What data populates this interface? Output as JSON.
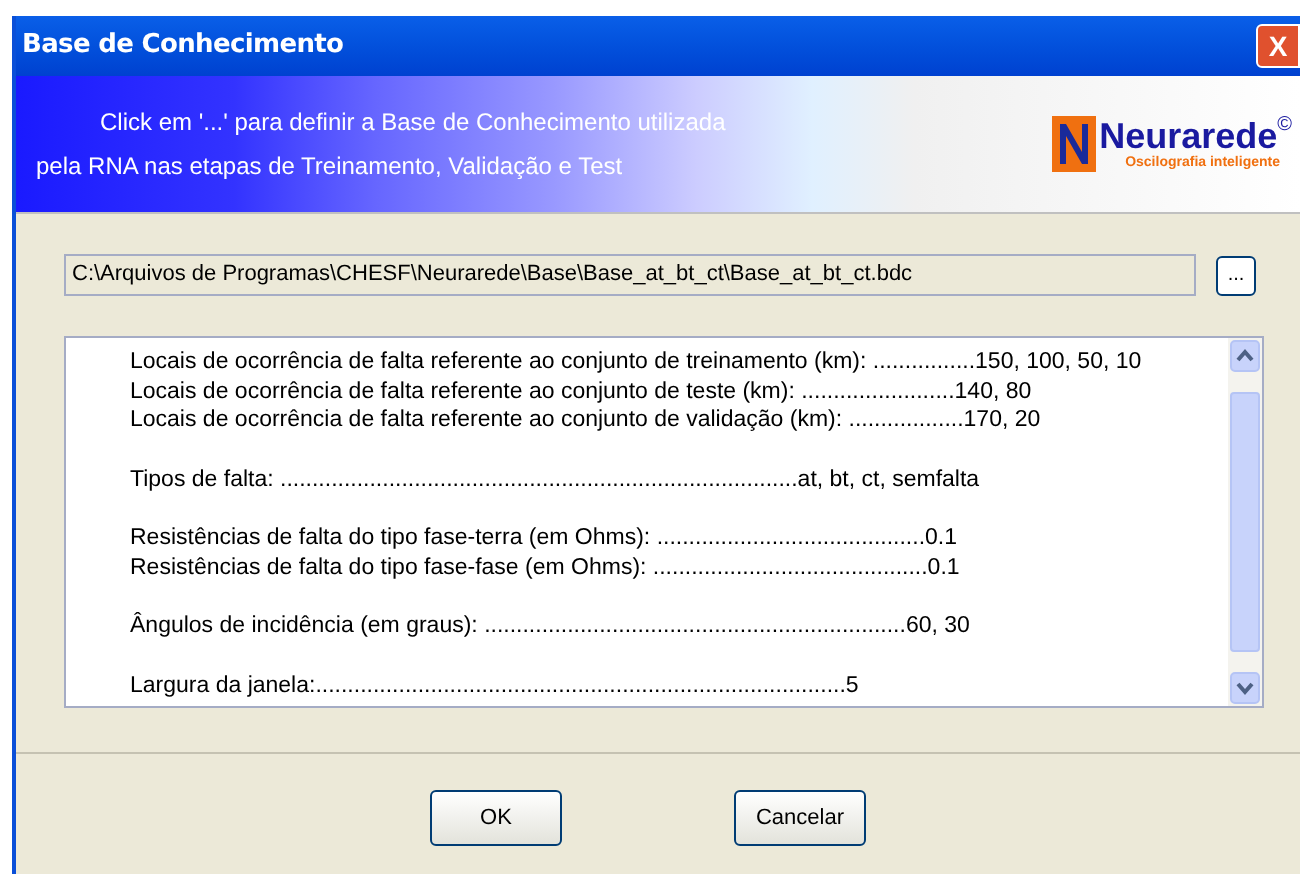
{
  "window": {
    "title": "Base de Conhecimento",
    "close": "X"
  },
  "banner": {
    "lines": [
      "Click em '...' para definir a Base de Conhecimento utilizada",
      "pela RNA nas etapas de Treinamento, Validação e Test"
    ],
    "logo": {
      "name": "Neurarede",
      "mark": "©",
      "tagline": "Oscilografia inteligente"
    }
  },
  "path_field": {
    "value": "C:\\Arquivos de Programas\\CHESF\\Neurarede\\Base\\Base_at_bt_ct\\Base_at_bt_ct.bdc"
  },
  "browse_button": "...",
  "details": [
    [
      "Locais de ocorrência de falta referente ao conjunto de treinamento (km): ................150, 100, 50, 10",
      "Locais de ocorrência de falta referente ao conjunto de teste (km): ........................140, 80",
      "Locais de ocorrência de falta referente ao conjunto de validação (km): ..................170, 20"
    ],
    [
      "Tipos de falta: .................................................................................at, bt, ct, semfalta"
    ],
    [
      "Resistências de falta do tipo fase-terra (em Ohms): ..........................................0.1",
      "Resistências de falta do tipo fase-fase (em Ohms): ...........................................0.1"
    ],
    [
      "Ângulos de incidência (em graus): ..................................................................60, 30"
    ],
    [
      "Largura da janela:...................................................................................5"
    ]
  ],
  "buttons": [
    "OK",
    "Cancelar"
  ]
}
